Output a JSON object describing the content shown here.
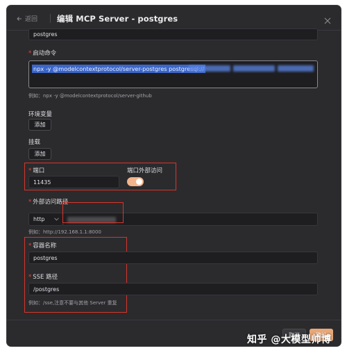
{
  "header": {
    "back_label": "返回",
    "title": "编辑 MCP Server - postgres"
  },
  "form": {
    "name_value": "postgres",
    "command": {
      "label": "启动命令",
      "value_visible": "npx -y @modelcontextprotocol/server-postgres postgresql://",
      "hint": "例如：npx -y @modelcontextprotocol/server-github"
    },
    "env": {
      "label": "环境变量",
      "add_label": "添加"
    },
    "mount": {
      "label": "挂载",
      "add_label": "添加"
    },
    "port": {
      "label": "端口",
      "value": "11435"
    },
    "external_access": {
      "label": "端口外部访问",
      "enabled": true
    },
    "external_path": {
      "label": "外部访问路径",
      "protocol": "http",
      "hint": "例如：http://192.168.1.1:8000"
    },
    "container": {
      "label": "容器名称",
      "value": "postgres"
    },
    "sse": {
      "label": "SSE 路径",
      "value": "/postgres",
      "hint": "例如：/sse,注意不要与其他 Server 重复"
    }
  },
  "footer": {
    "cancel_label": "取消",
    "confirm_label": "确认"
  },
  "watermark": "知乎 @大模型帅博",
  "colors": {
    "dialog_bg": "#2b2b2e",
    "input_bg": "#1e1e21",
    "toggle_on": "#f2b48a",
    "required": "#e04a3a",
    "highlight_box": "#d8352a",
    "selection": "#3b66c9"
  }
}
